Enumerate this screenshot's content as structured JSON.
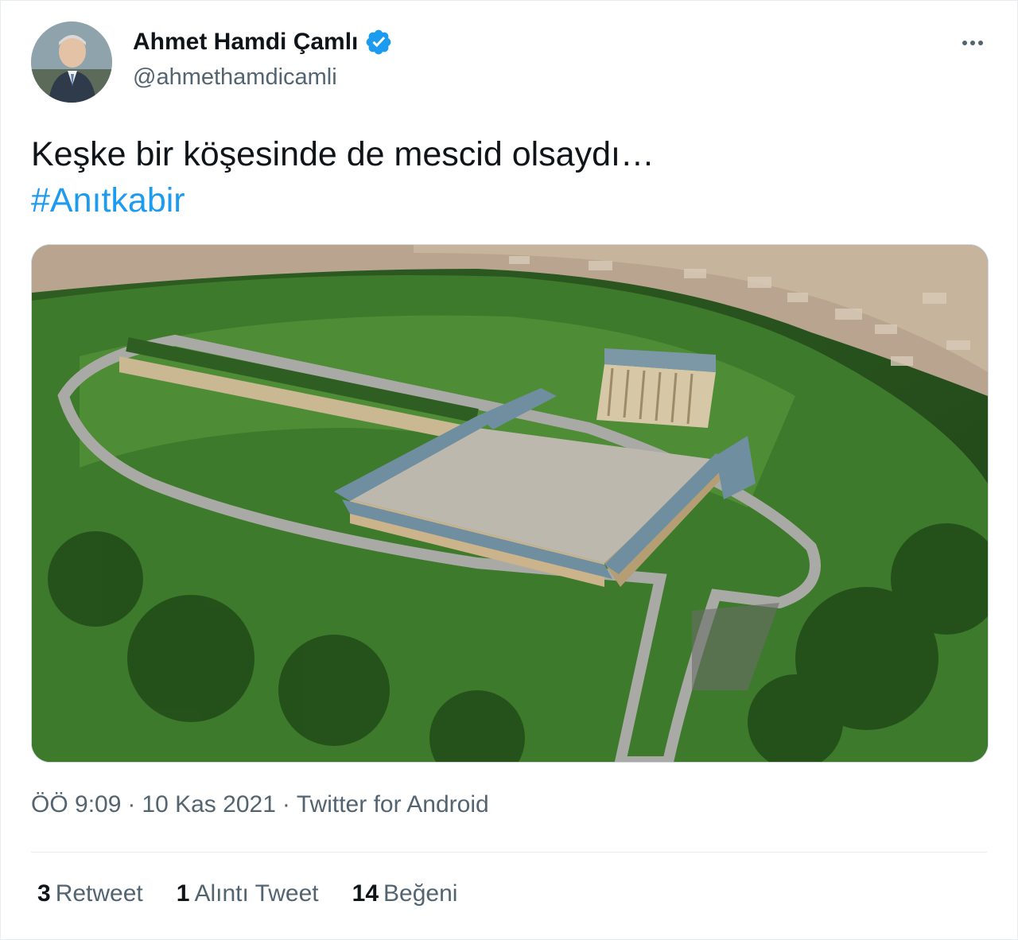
{
  "author": {
    "name": "Ahmet Hamdi Çamlı",
    "handle": "@ahmethamdicamli",
    "verified_icon": "verified-badge-icon"
  },
  "tweet": {
    "text": "Keşke bir köşesinde de mescid olsaydı…",
    "hashtag": "#Anıtkabir"
  },
  "meta": {
    "time": "ÖÖ 9:09",
    "separator": "·",
    "date": "10 Kas 2021",
    "source": "Twitter for Android"
  },
  "stats": {
    "retweets_count": "3",
    "retweets_label": "Retweet",
    "quotes_count": "1",
    "quotes_label": "Alıntı Tweet",
    "likes_count": "14",
    "likes_label": "Beğeni"
  },
  "colors": {
    "link": "#1d9bf0",
    "secondary_text": "#536471",
    "primary_text": "#0f1419",
    "divider": "#e6ecf0"
  }
}
